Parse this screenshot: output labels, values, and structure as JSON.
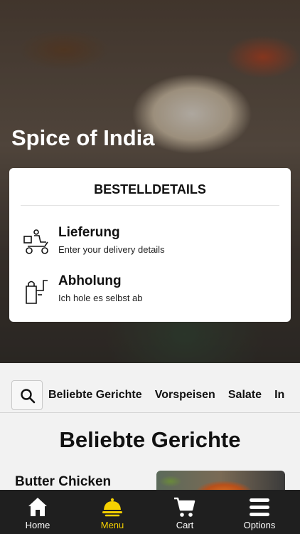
{
  "restaurant": {
    "name": "Spice of India"
  },
  "order_card": {
    "title": "BESTELLDETAILS",
    "options": [
      {
        "title": "Lieferung",
        "subtitle": "Enter your delivery details",
        "icon": "delivery-scooter-icon"
      },
      {
        "title": "Abholung",
        "subtitle": "Ich hole es selbst ab",
        "icon": "takeaway-bag-icon"
      }
    ]
  },
  "categories": [
    "Beliebte Gerichte",
    "Vorspeisen",
    "Salate",
    "In"
  ],
  "section": {
    "title": "Beliebte Gerichte"
  },
  "dishes": [
    {
      "name": "Butter Chicken"
    }
  ],
  "bottom_nav": [
    {
      "label": "Home",
      "icon": "home-icon"
    },
    {
      "label": "Menu",
      "icon": "menu-cloche-icon",
      "active": true
    },
    {
      "label": "Cart",
      "icon": "cart-icon"
    },
    {
      "label": "Options",
      "icon": "hamburger-icon"
    }
  ],
  "colors": {
    "accent": "#f5d000",
    "nav_bg": "#1f1f1f"
  }
}
